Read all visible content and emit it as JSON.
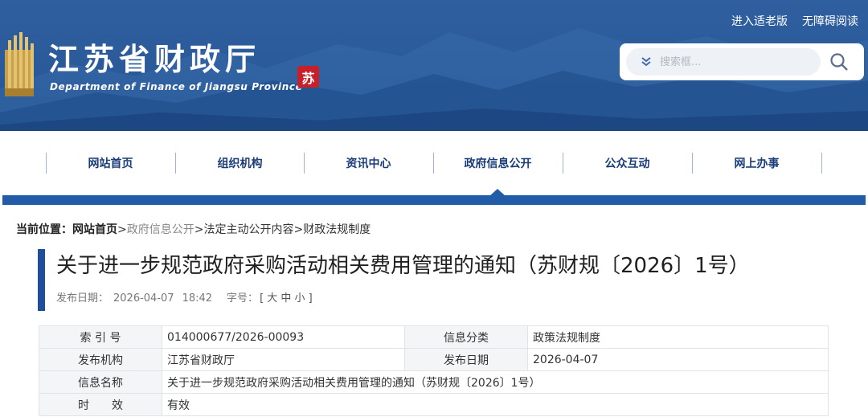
{
  "header": {
    "links": [
      "进入适老版",
      "无障碍阅读"
    ],
    "logo_cn": "江苏省财政厅",
    "logo_en": "Department of Finance of Jiangsu Province",
    "seal_char": "苏",
    "search": {
      "placeholder": "搜索框..."
    },
    "icons": {
      "chevron": "chevron-double-down-icon",
      "search": "search-icon"
    }
  },
  "nav": {
    "items": [
      "网站首页",
      "组织机构",
      "资讯中心",
      "政府信息公开",
      "公众互动",
      "网上办事"
    ],
    "active_index": 3
  },
  "breadcrumb": {
    "prefix": "当前位置：",
    "home": "网站首页",
    "crumbs": [
      "政府信息公开",
      "法定主动公开内容",
      "财政法规制度"
    ],
    "separator": ">"
  },
  "article": {
    "title": "关于进一步规范政府采购活动相关费用管理的通知（苏财规〔2026〕1号）",
    "publish_label": "发布日期：",
    "publish_date": "2026-04-07",
    "publish_time": "18:42",
    "fontsize_label": "字号：",
    "fontsize_options": "[ 大 中 小 ]"
  },
  "info_table": {
    "index_label": "索 引 号",
    "index_value": "014000677/2026-00093",
    "category_label": "信息分类",
    "category_value": "政策法规制度",
    "publisher_label": "发布机构",
    "publisher_value": "江苏省财政厅",
    "date_label": "发布日期",
    "date_value": "2026-04-07",
    "name_label": "信息名称",
    "name_value": "关于进一步规范政府采购活动相关费用管理的通知（苏财规〔2026〕1号）",
    "validity_label": "时　　效",
    "validity_value": "有效"
  },
  "colors": {
    "banner": "#2a5a99",
    "nav_text": "#1a3c78",
    "nav_bar": "#225ba8",
    "title_accent": "#1f4e9b",
    "seal": "#c8202a"
  }
}
